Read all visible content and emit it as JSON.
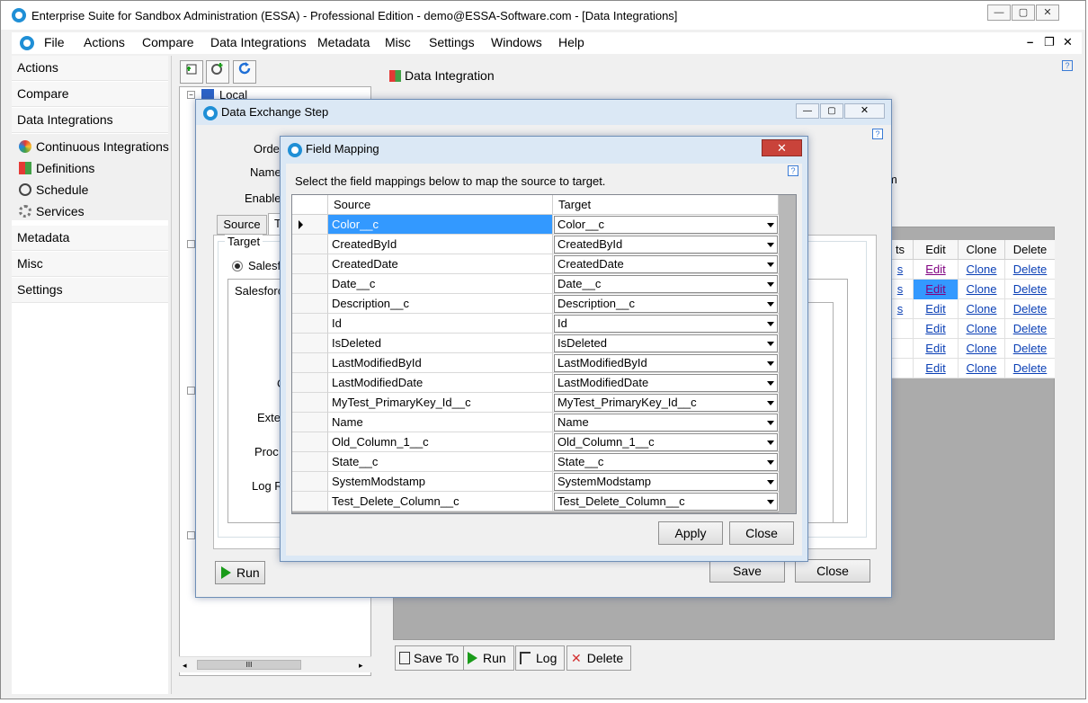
{
  "window": {
    "title": "Enterprise Suite for Sandbox Administration (ESSA) - Professional Edition - demo@ESSA-Software.com - [Data Integrations]",
    "controls": {
      "minimize": "—",
      "maximize": "▢",
      "close": "✕"
    }
  },
  "menubar": {
    "items": [
      "File",
      "Actions",
      "Compare",
      "Data Integrations",
      "Metadata",
      "Misc",
      "Settings",
      "Windows",
      "Help"
    ],
    "mdi_controls": {
      "minimize": "–",
      "restore": "❐",
      "close": "✕"
    }
  },
  "left_nav": {
    "sections": [
      "Actions",
      "Compare",
      "Data Integrations",
      "Metadata",
      "Misc",
      "Settings"
    ],
    "data_integrations_items": [
      "Continuous Integrations",
      "Definitions",
      "Schedule",
      "Services"
    ]
  },
  "content": {
    "help": "?",
    "tree": {
      "root_label": "Local"
    },
    "scroll_grip": "III",
    "header": "Data Integration",
    "grid": {
      "columns": [
        "ts",
        "Edit",
        "Clone",
        "Delete"
      ],
      "rows": [
        {
          "prefix": "s",
          "edit": "Edit",
          "clone": "Clone",
          "delete": "Delete"
        },
        {
          "prefix": "s",
          "edit": "Edit",
          "clone": "Clone",
          "delete": "Delete"
        },
        {
          "prefix": "s",
          "edit": "Edit",
          "clone": "Clone",
          "delete": "Delete"
        },
        {
          "prefix": "",
          "edit": "Edit",
          "clone": "Clone",
          "delete": "Delete"
        },
        {
          "prefix": "",
          "edit": "Edit",
          "clone": "Clone",
          "delete": "Delete"
        },
        {
          "prefix": "",
          "edit": "Edit",
          "clone": "Clone",
          "delete": "Delete"
        }
      ]
    },
    "partial_m": "m",
    "bottom_buttons": [
      "Save To",
      "Run",
      "Log",
      "Delete"
    ]
  },
  "des_window": {
    "title": "Data Exchange Step",
    "help": "?",
    "labels": {
      "order": "Orde",
      "name": "Name",
      "enable": "Enable"
    },
    "tabs": [
      "Source",
      "Ta"
    ],
    "target_group": "Target",
    "radio_label": "Salesf",
    "list_item": "Salesforc",
    "side_labels": [
      "O",
      "Exte",
      "Proc",
      "Log R"
    ],
    "run_label": "Run",
    "save_label": "Save",
    "close_label": "Close"
  },
  "fm_window": {
    "title": "Field Mapping",
    "help": "?",
    "close_x": "✕",
    "instruction": "Select the field mappings below to map the source to target.",
    "columns": {
      "source": "Source",
      "target": "Target"
    },
    "rows": [
      {
        "source": "Color__c",
        "target": "Color__c"
      },
      {
        "source": "CreatedById",
        "target": "CreatedById"
      },
      {
        "source": "CreatedDate",
        "target": "CreatedDate"
      },
      {
        "source": "Date__c",
        "target": "Date__c"
      },
      {
        "source": "Description__c",
        "target": "Description__c"
      },
      {
        "source": "Id",
        "target": "Id"
      },
      {
        "source": "IsDeleted",
        "target": "IsDeleted"
      },
      {
        "source": "LastModifiedById",
        "target": "LastModifiedById"
      },
      {
        "source": "LastModifiedDate",
        "target": "LastModifiedDate"
      },
      {
        "source": "MyTest_PrimaryKey_Id__c",
        "target": "MyTest_PrimaryKey_Id__c"
      },
      {
        "source": "Name",
        "target": "Name"
      },
      {
        "source": "Old_Column_1__c",
        "target": "Old_Column_1__c"
      },
      {
        "source": "State__c",
        "target": "State__c"
      },
      {
        "source": "SystemModstamp",
        "target": "SystemModstamp"
      },
      {
        "source": "Test_Delete_Column__c",
        "target": "Test_Delete_Column__c"
      }
    ],
    "apply_label": "Apply",
    "close_label": "Close"
  },
  "colors": {
    "accent": "#3399ff",
    "link": "#0a3fb5",
    "visited_link": "#800080",
    "close_red": "#c9433a",
    "run_green": "#1a9b1a"
  }
}
